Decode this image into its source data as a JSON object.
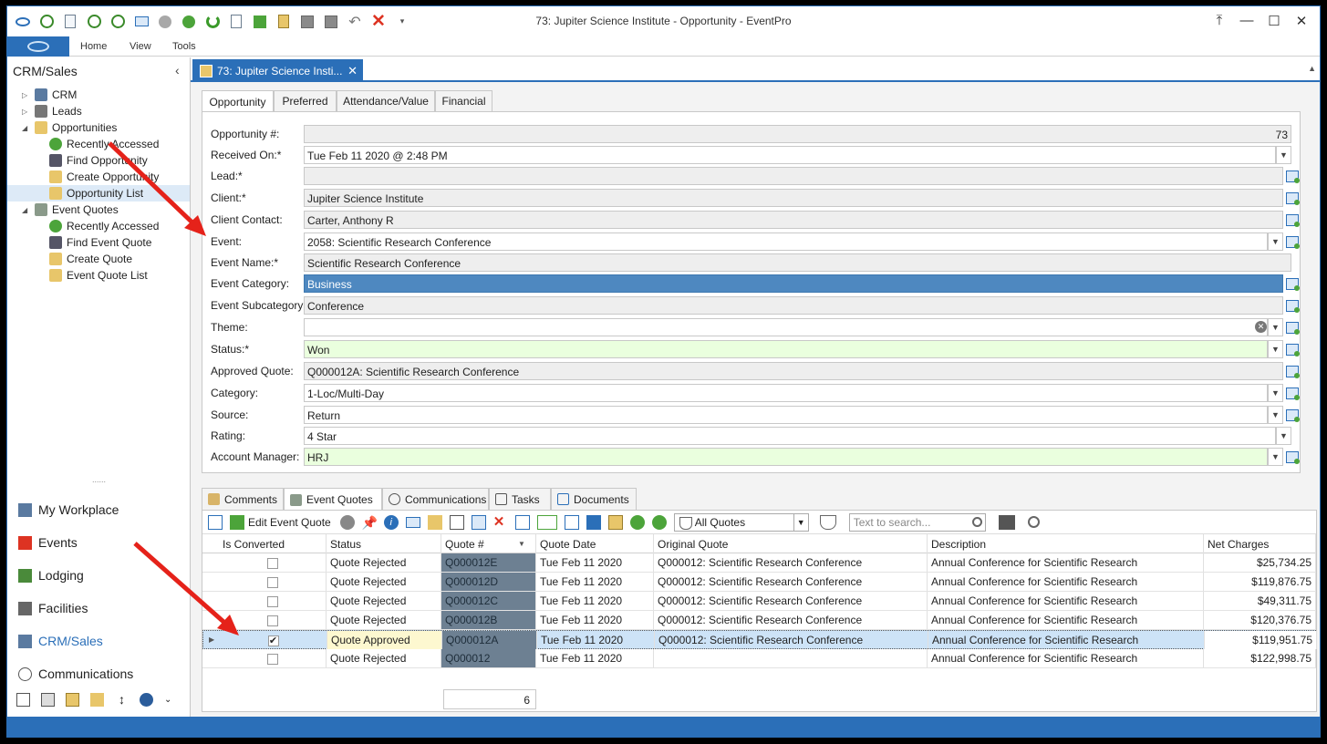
{
  "window": {
    "title": "73: Jupiter Science Institute - Opportunity - EventPro"
  },
  "ribbon": {
    "tabs": [
      "Home",
      "View",
      "Tools"
    ]
  },
  "sidebar": {
    "title": "CRM/Sales",
    "tree": [
      {
        "label": "CRM",
        "level": 0,
        "expand": "collapsed",
        "icon": "crm-icon"
      },
      {
        "label": "Leads",
        "level": 0,
        "expand": "collapsed",
        "icon": "person-icon"
      },
      {
        "label": "Opportunities",
        "level": 0,
        "expand": "expanded",
        "icon": "opportunity-icon"
      },
      {
        "label": "Recently Accessed",
        "level": 1,
        "icon": "clock-icon"
      },
      {
        "label": "Find Opportunity",
        "level": 1,
        "icon": "binoculars-icon"
      },
      {
        "label": "Create Opportunity",
        "level": 1,
        "icon": "create-icon"
      },
      {
        "label": "Opportunity List",
        "level": 1,
        "icon": "list-icon",
        "selected": true
      },
      {
        "label": "Event Quotes",
        "level": 0,
        "expand": "expanded",
        "icon": "quote-icon"
      },
      {
        "label": "Recently Accessed",
        "level": 1,
        "icon": "clock-icon"
      },
      {
        "label": "Find Event Quote",
        "level": 1,
        "icon": "binoculars-icon"
      },
      {
        "label": "Create Quote",
        "level": 1,
        "icon": "create-icon"
      },
      {
        "label": "Event Quote List",
        "level": 1,
        "icon": "list-icon"
      }
    ],
    "splitter": "......",
    "nav": [
      {
        "label": "My Workplace",
        "icon": "home-icon"
      },
      {
        "label": "Events",
        "icon": "pin-icon"
      },
      {
        "label": "Lodging",
        "icon": "bed-icon"
      },
      {
        "label": "Facilities",
        "icon": "facilities-icon"
      },
      {
        "label": "CRM/Sales",
        "icon": "crm-sales-icon",
        "active": true
      },
      {
        "label": "Communications",
        "icon": "speech-icon"
      }
    ]
  },
  "doc_tab": {
    "label": "73: Jupiter Science Insti..."
  },
  "form_tabs": [
    "Opportunity",
    "Preferred",
    "Attendance/Value",
    "Financial"
  ],
  "form": {
    "opportunity_no_label": "Opportunity #:",
    "opportunity_no": "73",
    "received_on_label": "Received On:*",
    "received_on": "Tue Feb 11 2020 @ 2:48 PM",
    "lead_label": "Lead:*",
    "lead": "",
    "client_label": "Client:*",
    "client": "Jupiter Science Institute",
    "client_contact_label": "Client Contact:",
    "client_contact": "Carter, Anthony R",
    "event_label": "Event:",
    "event": "2058: Scientific Research Conference",
    "event_name_label": "Event Name:*",
    "event_name": "Scientific Research Conference",
    "event_category_label": "Event Category:",
    "event_category": "Business",
    "event_subcategory_label": "Event Subcategory:",
    "event_subcategory": "Conference",
    "theme_label": "Theme:",
    "theme": "",
    "status_label": "Status:*",
    "status": "Won",
    "approved_quote_label": "Approved Quote:",
    "approved_quote": "Q000012A: Scientific Research Conference",
    "category_label": "Category:",
    "category": "1-Loc/Multi-Day",
    "source_label": "Source:",
    "source": "Return",
    "rating_label": "Rating:",
    "rating": "4 Star",
    "account_manager_label": "Account Manager:",
    "account_manager": "HRJ"
  },
  "bottom_tabs": [
    {
      "label": "Comments",
      "icon": "comments-icon"
    },
    {
      "label": "Event Quotes",
      "icon": "event-quotes-icon",
      "active": true
    },
    {
      "label": "Communications",
      "icon": "speech-icon"
    },
    {
      "label": "Tasks",
      "icon": "tasks-icon"
    },
    {
      "label": "Documents",
      "icon": "documents-icon"
    }
  ],
  "grid_toolbar": {
    "edit_label": "Edit Event Quote",
    "filter_value": "All Quotes",
    "search_placeholder": "Text to search..."
  },
  "grid": {
    "columns": [
      "Is Converted",
      "Status",
      "Quote #",
      "Quote Date",
      "Original Quote",
      "Description",
      "Net Charges"
    ],
    "rows": [
      {
        "converted": false,
        "status": "Quote Rejected",
        "quote": "Q000012E",
        "date": "Tue Feb 11 2020",
        "original": "Q000012: Scientific Research Conference",
        "desc": "Annual Conference for Scientific Research",
        "net": "$25,734.25"
      },
      {
        "converted": false,
        "status": "Quote Rejected",
        "quote": "Q000012D",
        "date": "Tue Feb 11 2020",
        "original": "Q000012: Scientific Research Conference",
        "desc": "Annual Conference for Scientific Research",
        "net": "$119,876.75"
      },
      {
        "converted": false,
        "status": "Quote Rejected",
        "quote": "Q000012C",
        "date": "Tue Feb 11 2020",
        "original": "Q000012: Scientific Research Conference",
        "desc": "Annual Conference for Scientific Research",
        "net": "$49,311.75"
      },
      {
        "converted": false,
        "status": "Quote Rejected",
        "quote": "Q000012B",
        "date": "Tue Feb 11 2020",
        "original": "Q000012: Scientific Research Conference",
        "desc": "Annual Conference for Scientific Research",
        "net": "$120,376.75"
      },
      {
        "converted": true,
        "status": "Quote Approved",
        "quote": "Q000012A",
        "date": "Tue Feb 11 2020",
        "original": "Q000012: Scientific Research Conference",
        "desc": "Annual Conference for Scientific Research",
        "net": "$119,951.75",
        "selected": true
      },
      {
        "converted": false,
        "status": "Quote Rejected",
        "quote": "Q000012",
        "date": "Tue Feb 11 2020",
        "original": "",
        "desc": "Annual Conference for Scientific Research",
        "net": "$122,998.75"
      }
    ],
    "count": "6"
  },
  "colors": {
    "accent": "#2b6fb8",
    "required_green": "#eaffde",
    "category_blue": "#4e88c0",
    "annotation_red": "#e5221a"
  }
}
